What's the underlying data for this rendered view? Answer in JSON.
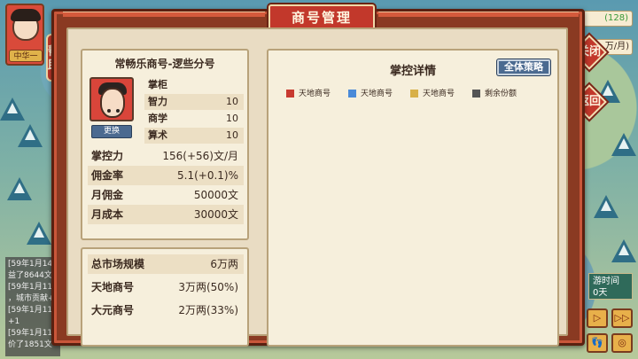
{
  "window": {
    "title": "商号管理"
  },
  "player": {
    "name_tag": "中华一"
  },
  "help_button": "帮助",
  "hud": {
    "coins": "(128)",
    "income": "万/月)",
    "game_time_label": "游时间",
    "game_time_value": "0天"
  },
  "buttons": {
    "close": "关闭",
    "back": "返回"
  },
  "controls": [
    "▷",
    "▷▷",
    "👣",
    "◎"
  ],
  "log_lines": [
    "[59年1月14",
    "益了8644文",
    "[59年1月11",
    "，城市贡献+",
    "[59年1月11",
    "+1",
    "[59年1月11",
    "价了1851文"
  ],
  "shop": {
    "name": "常畅乐商号-逻些分号",
    "manager_label": "掌柜",
    "change_button": "更换",
    "manager_stats": [
      {
        "label": "智力",
        "value": "10"
      },
      {
        "label": "商学",
        "value": "10"
      },
      {
        "label": "算术",
        "value": "10"
      }
    ],
    "metrics": [
      {
        "label": "掌控力",
        "value": "156(+56)文/月"
      },
      {
        "label": "佣金率",
        "value": "5.1(+0.1)%"
      },
      {
        "label": "月佣金",
        "value": "50000文"
      },
      {
        "label": "月成本",
        "value": "30000文"
      }
    ]
  },
  "market": {
    "rows": [
      {
        "label": "总市场规模",
        "value": "6万两"
      },
      {
        "label": "天地商号",
        "value": "3万两(50%)"
      },
      {
        "label": "大元商号",
        "value": "2万两(33%)"
      }
    ]
  },
  "details": {
    "title": "掌控详情",
    "strategy_button": "全体策略",
    "legend": [
      {
        "label": "天地商号",
        "color": "#c83a30"
      },
      {
        "label": "天地商号",
        "color": "#4a8ad8"
      },
      {
        "label": "天地商号",
        "color": "#d8b048"
      },
      {
        "label": "剩余份额",
        "color": "#555555"
      }
    ]
  }
}
